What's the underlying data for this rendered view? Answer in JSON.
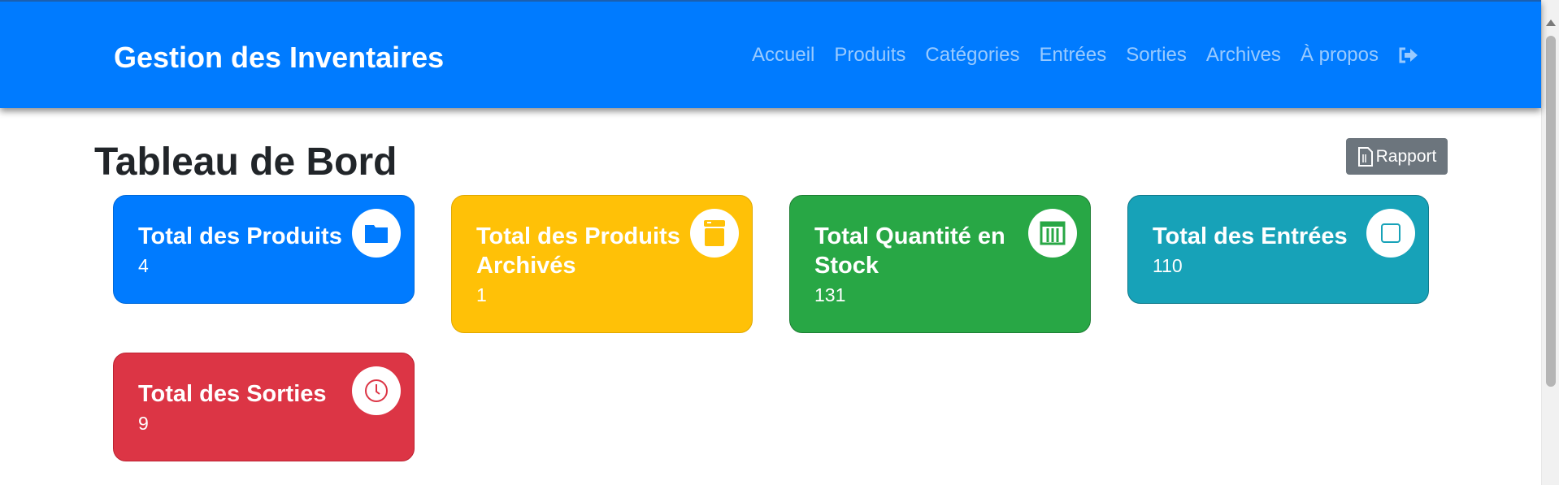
{
  "navbar": {
    "brand": "Gestion des Inventaires",
    "links": [
      "Accueil",
      "Produits",
      "Catégories",
      "Entrées",
      "Sorties",
      "Archives",
      "À propos"
    ],
    "logout_icon": "sign-out-icon"
  },
  "page": {
    "title": "Tableau de Bord",
    "report_button": "Rapport",
    "report_icon": "file-pdf-icon"
  },
  "cards": [
    {
      "title": "Total des Produits",
      "value": "4",
      "icon": "box-icon",
      "color": "#007bff"
    },
    {
      "title": "Total des Produits Archivés",
      "value": "1",
      "icon": "archive-icon",
      "color": "#ffc107"
    },
    {
      "title": "Total Quantité en Stock",
      "value": "131",
      "icon": "warehouse-icon",
      "color": "#28a745"
    },
    {
      "title": "Total des Entrées",
      "value": "110",
      "icon": "square-icon",
      "color": "#17a2b8"
    },
    {
      "title": "Total des Sorties",
      "value": "9",
      "icon": "clock-icon",
      "color": "#dc3545"
    }
  ]
}
